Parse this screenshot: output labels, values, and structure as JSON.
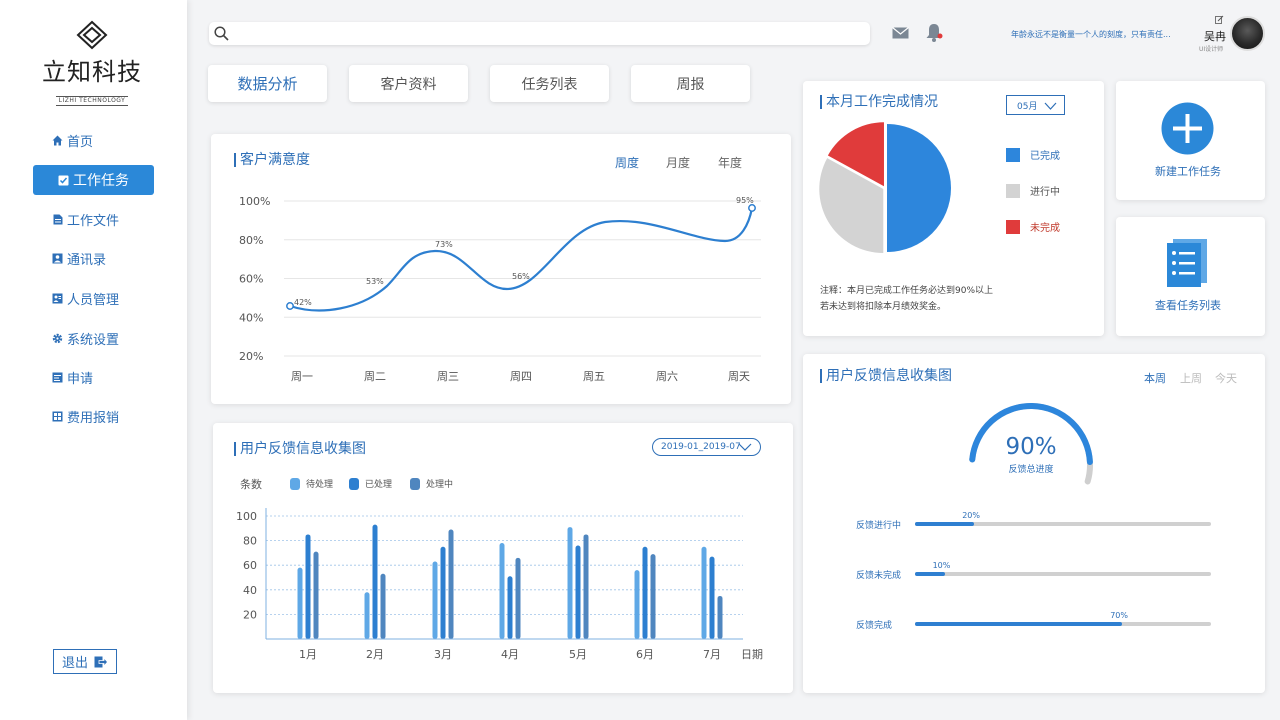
{
  "brand": {
    "name": "立知科技",
    "sub": "LIZHI TECHNOLOGY"
  },
  "nav": {
    "items": [
      {
        "label": "首页",
        "icon": "home-icon"
      },
      {
        "label": "工作任务",
        "icon": "task-icon",
        "active": true
      },
      {
        "label": "工作文件",
        "icon": "file-icon"
      },
      {
        "label": "通讯录",
        "icon": "contacts-icon"
      },
      {
        "label": "人员管理",
        "icon": "people-icon"
      },
      {
        "label": "系统设置",
        "icon": "gear-icon"
      },
      {
        "label": "申请",
        "icon": "apply-icon"
      },
      {
        "label": "费用报销",
        "icon": "expense-icon"
      }
    ],
    "logout": "退出"
  },
  "topbar": {
    "search_placeholder": "",
    "motto": "年龄永远不是衡量一个人的刻度，只有责任...",
    "user_name": "吴冉",
    "user_role": "UI设计师"
  },
  "tabs": [
    "数据分析",
    "客户资料",
    "任务列表",
    "周报"
  ],
  "satisfaction": {
    "title": "客户满意度",
    "periods": [
      "周度",
      "月度",
      "年度"
    ],
    "chart_data": {
      "type": "line",
      "categories": [
        "周一",
        "周二",
        "周三",
        "周四",
        "周五",
        "周六",
        "周天"
      ],
      "y_ticks": [
        "100%",
        "80%",
        "60%",
        "40%",
        "20%"
      ],
      "ylim": [
        20,
        100
      ],
      "labeled_points": [
        {
          "label": "42%",
          "value": 42
        },
        {
          "label": "53%",
          "value": 53
        },
        {
          "label": "73%",
          "value": 73
        },
        {
          "label": "56%",
          "value": 56
        },
        {
          "label": "95%",
          "value": 95
        }
      ]
    }
  },
  "feedback_bars": {
    "title": "用户反馈信息收集图",
    "date_range": "2019-01_2019-07",
    "y_label": "条数",
    "x_label": "日期",
    "chart_data": {
      "type": "bar",
      "categories": [
        "1月",
        "2月",
        "3月",
        "4月",
        "5月",
        "6月",
        "7月"
      ],
      "y_ticks": [
        "100",
        "80",
        "60",
        "40",
        "20"
      ],
      "ylim": [
        0,
        100
      ],
      "series": [
        {
          "name": "待处理",
          "color": "#5fa8e6",
          "values": [
            58,
            38,
            63,
            78,
            91,
            56,
            75
          ]
        },
        {
          "name": "已处理",
          "color": "#2d7fd0",
          "values": [
            85,
            93,
            75,
            51,
            76,
            75,
            67
          ]
        },
        {
          "name": "处理中",
          "color": "#4f86bf",
          "values": [
            71,
            53,
            89,
            66,
            85,
            69,
            35
          ]
        }
      ]
    }
  },
  "monthly": {
    "title": "本月工作完成情况",
    "month": "05月",
    "chart_data": {
      "type": "pie",
      "slices": [
        {
          "name": "已完成",
          "value": 50,
          "color": "#2d86dc"
        },
        {
          "name": "进行中",
          "value": 33,
          "color": "#d3d3d3"
        },
        {
          "name": "未完成",
          "value": 17,
          "color": "#e03b3b"
        }
      ]
    },
    "legend_colors": {
      "已完成": "#2e6fb7",
      "进行中": "#555555",
      "未完成": "#c0392b"
    },
    "note_line1": "注释：本月已完成工作任务必达到90%以上",
    "note_line2": "若未达到将扣除本月绩效奖金。"
  },
  "quick": {
    "new_task": "新建工作任务",
    "view_tasks": "查看任务列表"
  },
  "feedback_progress": {
    "title": "用户反馈信息收集图",
    "periods": [
      "本周",
      "上周",
      "今天"
    ],
    "gauge_value": "90%",
    "gauge_fraction": 0.9,
    "gauge_label": "反馈总进度",
    "rows": [
      {
        "label": "反馈进行中",
        "pct": "20%",
        "value": 0.2
      },
      {
        "label": "反馈未完成",
        "pct": "10%",
        "value": 0.1
      },
      {
        "label": "反馈完成",
        "pct": "70%",
        "value": 0.7
      }
    ]
  }
}
